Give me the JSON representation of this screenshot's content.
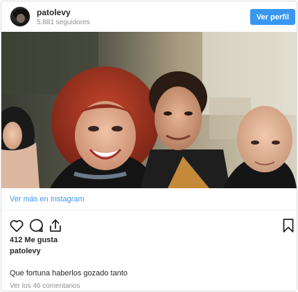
{
  "header": {
    "username": "patolevy",
    "followers": "5.881 seguidores",
    "profile_button": "Ver perfil"
  },
  "photo": {
    "description_icon": "photo-image"
  },
  "link": {
    "see_more": "Ver más en Instagram"
  },
  "actions": {
    "like_icon": "heart-icon",
    "comment_icon": "comment-icon",
    "share_icon": "share-icon",
    "save_icon": "bookmark-icon"
  },
  "stats": {
    "likes": "412 Me gusta"
  },
  "caption": {
    "username": "patolevy",
    "text": "Que fortuna haberlos gozado tanto"
  },
  "comments": {
    "view_all": "Ver los 46 comentarios"
  },
  "colors": {
    "accent": "#3897f0",
    "text": "#262626",
    "muted": "#8e8e8e",
    "border": "#dbdbdb"
  }
}
